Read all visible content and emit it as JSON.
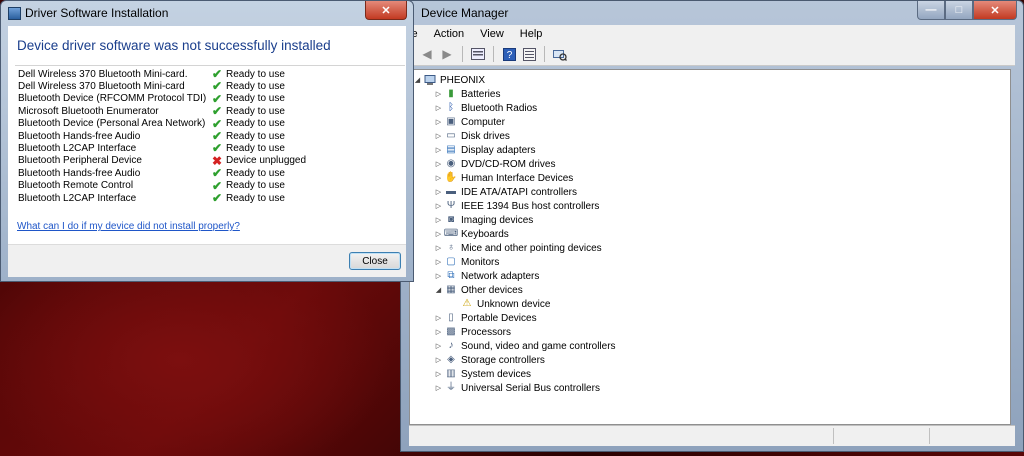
{
  "device_manager": {
    "title": "Device Manager",
    "menu": [
      "le",
      "Action",
      "View",
      "Help"
    ],
    "computer_name": "PHEONIX",
    "categories": [
      {
        "label": "Batteries",
        "icon": "battery-icon"
      },
      {
        "label": "Bluetooth Radios",
        "icon": "bluetooth-icon"
      },
      {
        "label": "Computer",
        "icon": "computer-icon"
      },
      {
        "label": "Disk drives",
        "icon": "disk-drive-icon"
      },
      {
        "label": "Display adapters",
        "icon": "display-adapter-icon"
      },
      {
        "label": "DVD/CD-ROM drives",
        "icon": "dvd-drive-icon"
      },
      {
        "label": "Human Interface Devices",
        "icon": "hid-icon"
      },
      {
        "label": "IDE ATA/ATAPI controllers",
        "icon": "ide-controller-icon"
      },
      {
        "label": "IEEE 1394 Bus host controllers",
        "icon": "ieee1394-icon"
      },
      {
        "label": "Imaging devices",
        "icon": "camera-icon"
      },
      {
        "label": "Keyboards",
        "icon": "keyboard-icon"
      },
      {
        "label": "Mice and other pointing devices",
        "icon": "mouse-icon"
      },
      {
        "label": "Monitors",
        "icon": "monitor-icon"
      },
      {
        "label": "Network adapters",
        "icon": "network-icon"
      },
      {
        "label": "Other devices",
        "icon": "other-devices-icon",
        "expanded": true
      },
      {
        "label": "Unknown device",
        "icon": "warning-device-icon",
        "child": true
      },
      {
        "label": "Portable Devices",
        "icon": "portable-device-icon"
      },
      {
        "label": "Processors",
        "icon": "processor-icon"
      },
      {
        "label": "Sound, video and game controllers",
        "icon": "speaker-icon"
      },
      {
        "label": "Storage controllers",
        "icon": "storage-icon"
      },
      {
        "label": "System devices",
        "icon": "system-icon"
      },
      {
        "label": "Universal Serial Bus controllers",
        "icon": "usb-icon"
      }
    ]
  },
  "dialog": {
    "title": "Driver Software Installation",
    "heading": "Device driver software was not successfully installed",
    "devices": [
      {
        "name": "Dell Wireless 370 Bluetooth Mini-card.",
        "status": "Ready to use",
        "ok": true
      },
      {
        "name": "Dell Wireless 370 Bluetooth Mini-card",
        "status": "Ready to use",
        "ok": true
      },
      {
        "name": "Bluetooth Device (RFCOMM Protocol TDI)",
        "status": "Ready to use",
        "ok": true
      },
      {
        "name": "Microsoft Bluetooth Enumerator",
        "status": "Ready to use",
        "ok": true
      },
      {
        "name": "Bluetooth Device (Personal Area Network)",
        "status": "Ready to use",
        "ok": true
      },
      {
        "name": "Bluetooth Hands-free Audio",
        "status": "Ready to use",
        "ok": true
      },
      {
        "name": "Bluetooth L2CAP Interface",
        "status": "Ready to use",
        "ok": true
      },
      {
        "name": "Bluetooth Peripheral Device",
        "status": "Device unplugged",
        "ok": false
      },
      {
        "name": "Bluetooth Hands-free Audio",
        "status": "Ready to use",
        "ok": true
      },
      {
        "name": "Bluetooth Remote Control",
        "status": "Ready to use",
        "ok": true
      },
      {
        "name": "Bluetooth L2CAP Interface",
        "status": "Ready to use",
        "ok": true
      }
    ],
    "help_link": "What can I do if my device did not install properly?",
    "close_button": "Close",
    "colors": {
      "heading": "#1a3e8c",
      "ok": "#2ea02e",
      "error": "#d42222",
      "link": "#1f56c8"
    }
  }
}
